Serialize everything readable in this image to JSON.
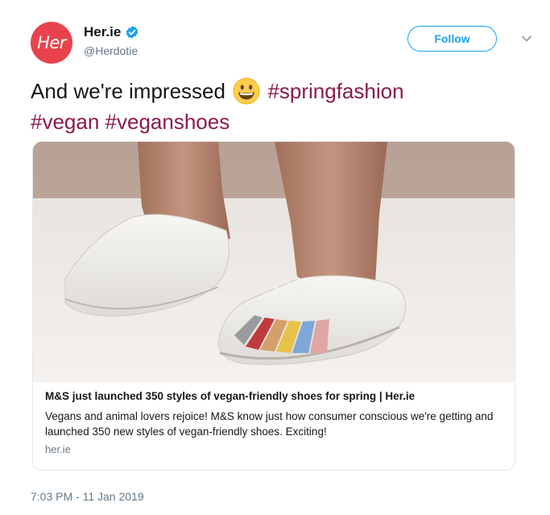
{
  "account": {
    "avatar_text": "Her",
    "display_name": "Her.ie",
    "handle": "@Herdotie",
    "verified_icon": "verified-badge-icon"
  },
  "follow_button": {
    "label": "Follow"
  },
  "menu_icon": "chevron-down-icon",
  "tweet": {
    "text_prefix": "And we're impressed",
    "emoji_icon": "grinning-face-emoji",
    "hashtag_1": "#springfashion",
    "hashtag_2": "#vegan",
    "hashtag_3": "#veganshoes"
  },
  "card": {
    "title": "M&S just launched 350 styles of vegan-friendly shoes for spring | Her.ie",
    "description": "Vegans and animal lovers rejoice! M&S know just how consumer conscious we're getting and launched 350 new styles of vegan-friendly shoes. Exciting!",
    "domain": "her.ie"
  },
  "timestamp": "7:03 PM - 11 Jan 2019",
  "colors": {
    "brand_red": "#e8434d",
    "link_blue": "#1da1f2",
    "hashtag": "#8b1a4d",
    "secondary_text": "#657786"
  }
}
